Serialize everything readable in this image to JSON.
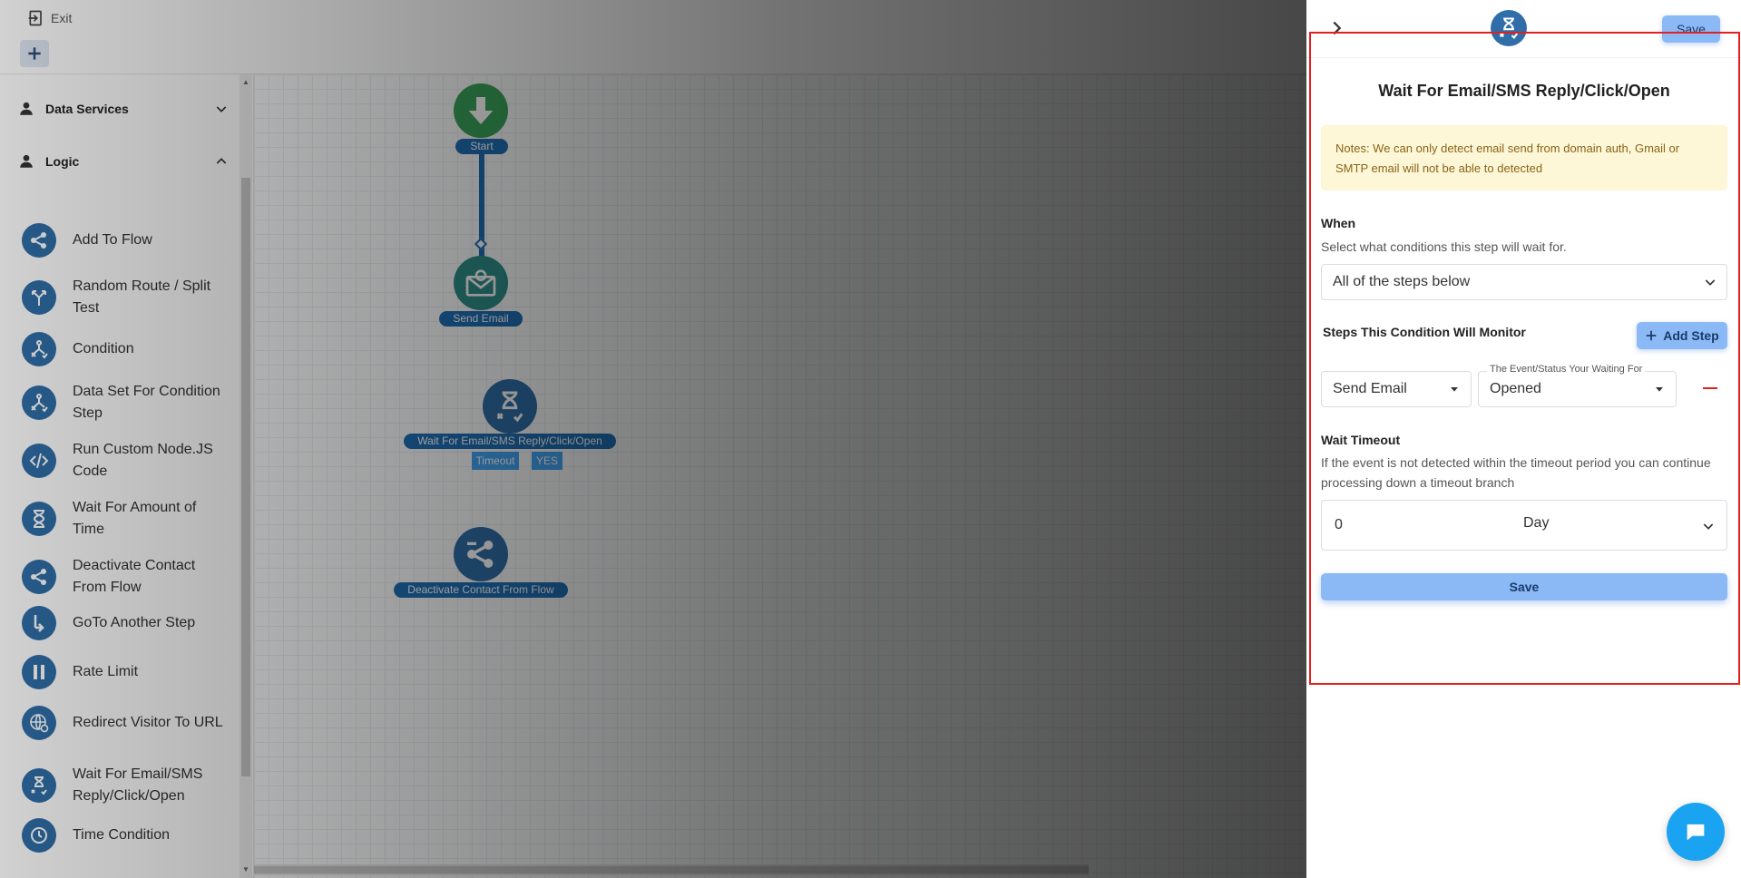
{
  "topbar": {
    "exit_label": "Exit"
  },
  "sidebar": {
    "sections": [
      {
        "label": "Data Services",
        "state": "collapsed"
      },
      {
        "label": "Logic",
        "state": "expanded"
      }
    ],
    "items": [
      {
        "label": "Add To Flow",
        "icon": "share-icon"
      },
      {
        "label": "Random Route / Split Test",
        "icon": "split-route-icon"
      },
      {
        "label": "Condition",
        "icon": "condition-icon"
      },
      {
        "label": "Data Set For Condition Step",
        "icon": "condition-icon"
      },
      {
        "label": "Run Custom Node.JS Code",
        "icon": "code-icon"
      },
      {
        "label": "Wait For Amount of Time",
        "icon": "hourglass-icon"
      },
      {
        "label": "Deactivate Contact From Flow",
        "icon": "share-icon"
      },
      {
        "label": "GoTo Another Step",
        "icon": "goto-arrow-icon"
      },
      {
        "label": "Rate Limit",
        "icon": "pause-icon"
      },
      {
        "label": "Redirect Visitor To URL",
        "icon": "globe-icon"
      },
      {
        "label": "Wait For Email/SMS Reply/Click/Open",
        "icon": "hourglass-icon"
      },
      {
        "label": "Time Condition",
        "icon": "clock-icon"
      }
    ]
  },
  "canvas": {
    "nodes": [
      {
        "label": "Start",
        "icon": "arrow-down-icon"
      },
      {
        "label": "Send Email",
        "icon": "email-icon"
      },
      {
        "label": "Wait For Email/SMS Reply/Click/Open",
        "icon": "hourglass-icon"
      },
      {
        "label": "Deactivate Contact From Flow",
        "icon": "share-icon"
      }
    ],
    "branches": [
      "Timeout",
      "YES"
    ]
  },
  "drawer": {
    "save_top_label": "Save",
    "title": "Wait For Email/SMS Reply/Click/Open",
    "notes": "Notes: We can only detect email send from domain auth, Gmail or SMTP email will not be able to detected",
    "when": {
      "title": "When",
      "help": "Select what conditions this step will wait for.",
      "selected": "All of the steps below"
    },
    "steps": {
      "title": "Steps This Condition Will Monitor",
      "add_label": "Add Step",
      "rows": [
        {
          "step": "Send Email",
          "event_label": "The Event/Status Your Waiting For",
          "event": "Opened"
        }
      ]
    },
    "timeout": {
      "title": "Wait Timeout",
      "help": "If the event is not detected within the timeout period you can continue processing down a timeout branch",
      "value": "0",
      "unit": "Day"
    },
    "save_label": "Save"
  },
  "colors": {
    "accent_button": "#8bb9f5",
    "node_blue": "#2f6ea8",
    "start_green": "#3aa35a",
    "notes_bg": "#fdf7d8",
    "highlight_frame": "#e32020",
    "chat": "#1aa3f0"
  }
}
